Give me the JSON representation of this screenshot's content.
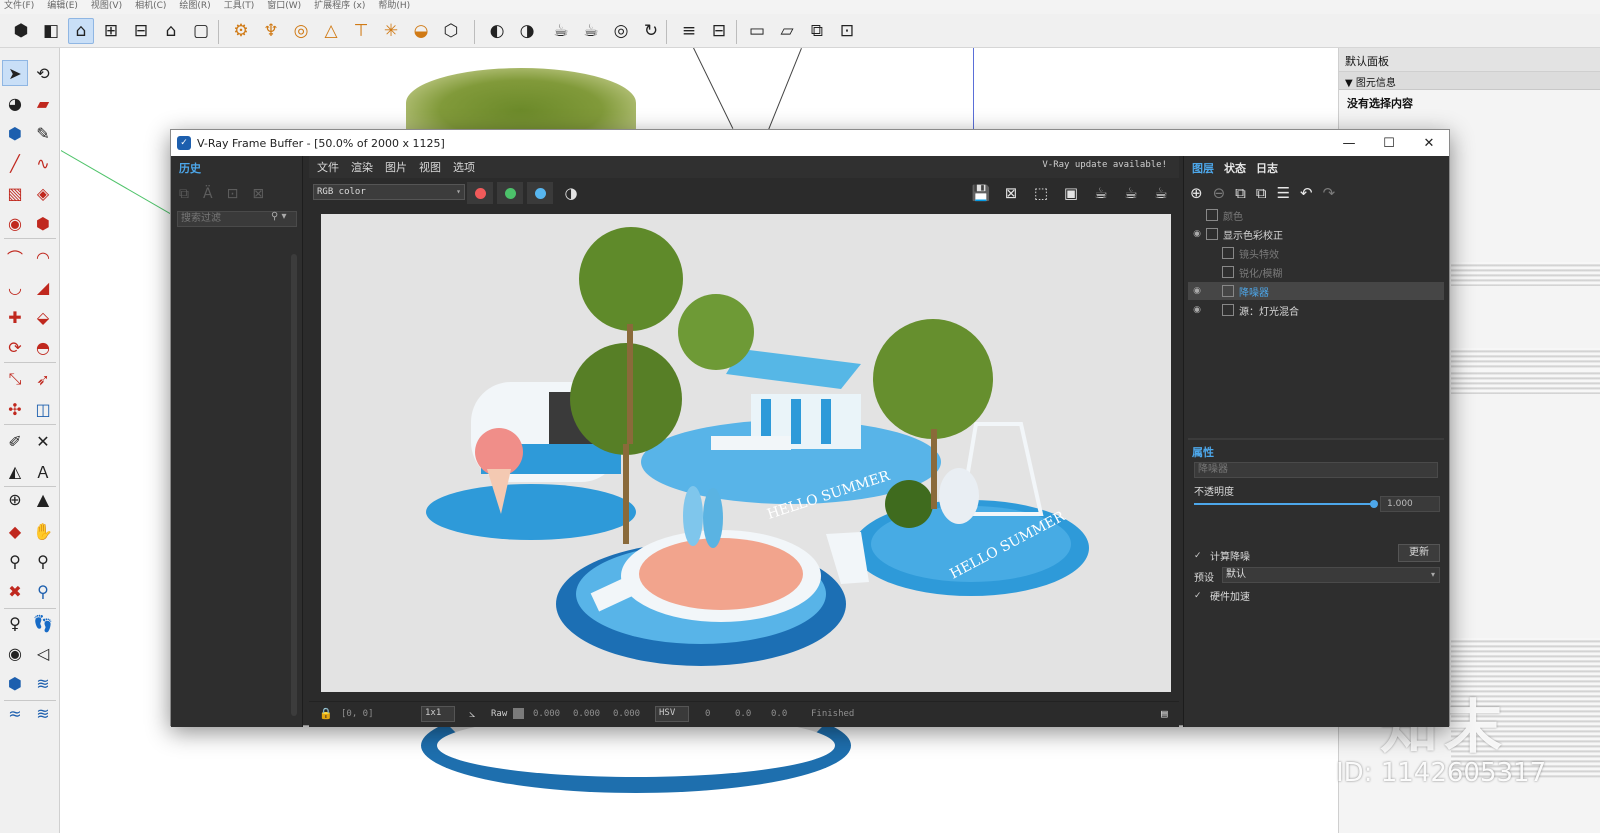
{
  "menubar": [
    "文件(F)",
    "编辑(E)",
    "视图(V)",
    "相机(C)",
    "绘图(R)",
    "工具(T)",
    "窗口(W)",
    "扩展程序 (x)",
    "帮助(H)"
  ],
  "top_toolbar": [
    {
      "name": "components-icon",
      "glyph": "⬢"
    },
    {
      "name": "materials-icon",
      "glyph": "◧"
    },
    {
      "name": "home-icon",
      "glyph": "⌂",
      "active": true
    },
    {
      "name": "warehouse-icon",
      "glyph": "⊞"
    },
    {
      "name": "store-icon",
      "glyph": "⊟"
    },
    {
      "name": "house-icon",
      "glyph": "⌂"
    },
    {
      "name": "box-icon",
      "glyph": "▢"
    },
    {
      "name": "vray-asset-editor-icon",
      "glyph": "⚙",
      "orange": true
    },
    {
      "name": "vray-render-icon",
      "glyph": "♆",
      "orange": true
    },
    {
      "name": "vray-interactive-icon",
      "glyph": "◎",
      "orange": true
    },
    {
      "name": "vray-batch-icon",
      "glyph": "△",
      "orange": true
    },
    {
      "name": "vray-light-icon",
      "glyph": "⊤",
      "orange": true
    },
    {
      "name": "vray-sun-icon",
      "glyph": "✳",
      "orange": true
    },
    {
      "name": "vray-dome-icon",
      "glyph": "◒",
      "orange": true
    },
    {
      "name": "vray-mesh-icon",
      "glyph": "⬡",
      "orange": false
    },
    {
      "name": "vray-proxy-icon",
      "glyph": "◐"
    },
    {
      "name": "vray-fur-icon",
      "glyph": "◑"
    },
    {
      "name": "vray-teapot-icon",
      "glyph": "☕"
    },
    {
      "name": "vray-teapot-play-icon",
      "glyph": "☕"
    },
    {
      "name": "vray-swirl-icon",
      "glyph": "◎"
    },
    {
      "name": "vray-refresh-icon",
      "glyph": "↻"
    },
    {
      "name": "vray-plane-icon",
      "glyph": "≡"
    },
    {
      "name": "vray-clipper-icon",
      "glyph": "⊟"
    },
    {
      "name": "vray-frame-icon",
      "glyph": "▭"
    },
    {
      "name": "vray-frame2-icon",
      "glyph": "▱"
    },
    {
      "name": "vray-frame3-icon",
      "glyph": "⧉"
    },
    {
      "name": "vray-lock-icon",
      "glyph": "⊡"
    }
  ],
  "left_toolbar": [
    {
      "name": "select-tool-icon",
      "glyph": "➤",
      "sel": true
    },
    {
      "name": "orbit-tool-icon",
      "glyph": "⟲"
    },
    {
      "name": "paint-bucket-icon",
      "glyph": "◕"
    },
    {
      "name": "eraser-icon",
      "glyph": "▰",
      "red": true
    },
    {
      "name": "component-tool-icon",
      "glyph": "⬢",
      "blue": true
    },
    {
      "name": "tape-measure-icon",
      "glyph": "✎"
    },
    {
      "name": "pencil-line-icon",
      "glyph": "╱",
      "red": true
    },
    {
      "name": "freehand-icon",
      "glyph": "∿",
      "red": true
    },
    {
      "name": "rectangle-icon",
      "glyph": "▧",
      "red": true
    },
    {
      "name": "rotated-rect-icon",
      "glyph": "◈",
      "red": true
    },
    {
      "name": "circle-icon",
      "glyph": "◉",
      "red": true
    },
    {
      "name": "polygon-icon",
      "glyph": "⬢",
      "red": true
    },
    {
      "name": "arc-icon",
      "glyph": "⌒",
      "red": true
    },
    {
      "name": "arc2-icon",
      "glyph": "◠",
      "red": true
    },
    {
      "name": "arc3-icon",
      "glyph": "◡",
      "red": true
    },
    {
      "name": "pie-icon",
      "glyph": "◢",
      "red": true
    },
    {
      "name": "move-icon",
      "glyph": "✚",
      "red": true
    },
    {
      "name": "push-pull-icon",
      "glyph": "⬙",
      "red": true
    },
    {
      "name": "rotate-icon",
      "glyph": "⟳",
      "red": true
    },
    {
      "name": "follow-me-icon",
      "glyph": "◓",
      "red": true
    },
    {
      "name": "scale-icon",
      "glyph": "⤡",
      "red": true
    },
    {
      "name": "offset-icon",
      "glyph": "➶",
      "red": true
    },
    {
      "name": "axes-icon",
      "glyph": "✣",
      "red": true
    },
    {
      "name": "outer-shell-icon",
      "glyph": "◫",
      "blue": true
    },
    {
      "name": "tape-icon",
      "glyph": "✐"
    },
    {
      "name": "dimension-icon",
      "glyph": "✕"
    },
    {
      "name": "protractor-icon",
      "glyph": "◭"
    },
    {
      "name": "text-icon",
      "glyph": "Ａ"
    },
    {
      "name": "axes-tool-icon",
      "glyph": "⊕"
    },
    {
      "name": "3d-text-icon",
      "glyph": "▲"
    },
    {
      "name": "orbit2-icon",
      "glyph": "◆",
      "red": true
    },
    {
      "name": "pan-icon",
      "glyph": "✋"
    },
    {
      "name": "zoom-icon",
      "glyph": "⚲"
    },
    {
      "name": "zoom-window-icon",
      "glyph": "⚲"
    },
    {
      "name": "zoom-extents-icon",
      "glyph": "✖",
      "red": true
    },
    {
      "name": "previous-view-icon",
      "glyph": "⚲",
      "blue": true
    },
    {
      "name": "position-camera-icon",
      "glyph": "♀"
    },
    {
      "name": "walk-icon",
      "glyph": "👣"
    },
    {
      "name": "look-around-icon",
      "glyph": "◉"
    },
    {
      "name": "section-plane-icon",
      "glyph": "◁"
    },
    {
      "name": "sandbox-icon",
      "glyph": "⬢",
      "blue": true
    },
    {
      "name": "terrain-icon",
      "glyph": "≋",
      "blue": true
    },
    {
      "name": "layers-icon",
      "glyph": "≈",
      "blue": true
    },
    {
      "name": "tools-icon",
      "glyph": "≋",
      "blue": true
    }
  ],
  "default_panel": {
    "title": "默认面板",
    "section": "▼ 图元信息",
    "note": "没有选择内容"
  },
  "watermark": {
    "logo": "知末",
    "id": "ID: 1142605317"
  },
  "vfb": {
    "title": "V-Ray Frame Buffer - [50.0% of 2000 x 1125]",
    "window_buttons": [
      "—",
      "☐",
      "✕"
    ],
    "history_tab": "历史",
    "history_search_placeholder": "搜索过滤",
    "menu": [
      "文件",
      "渲染",
      "图片",
      "视图",
      "选项"
    ],
    "update_note": "V-Ray update available!",
    "channel": "RGB color",
    "channel_colors": [
      "#f05a5a",
      "#4cc16a",
      "#57b6ef"
    ],
    "status": {
      "coords": "[0, 0]",
      "ratio": "1x1",
      "raw_label": "Raw",
      "raw_values": [
        "0.000",
        "0.000",
        "0.000"
      ],
      "mode": "HSV",
      "hsv_values": [
        "0",
        "0.0",
        "0.0"
      ],
      "state": "Finished"
    },
    "layer_tabs": [
      "图层",
      "状态",
      "日志"
    ],
    "layers": [
      {
        "label": "颜色",
        "dim": true,
        "indent": 0,
        "eye": false
      },
      {
        "label": "显示色彩校正",
        "dim": false,
        "indent": 0,
        "eye": true
      },
      {
        "label": "镜头特效",
        "dim": true,
        "indent": 1,
        "eye": false
      },
      {
        "label": "锐化/模糊",
        "dim": true,
        "indent": 1,
        "eye": false
      },
      {
        "label": "降噪器",
        "dim": false,
        "indent": 1,
        "eye": true,
        "sel": true,
        "accent": true
      },
      {
        "label": "源：灯光混合",
        "dim": false,
        "indent": 1,
        "eye": true
      }
    ],
    "properties": {
      "title": "属性",
      "name_field": "降噪器",
      "opacity_label": "不透明度",
      "opacity_value": "1.000",
      "opacity": 1.0,
      "compute_label": "计算降噪",
      "update_button": "更新",
      "preset_label": "预设",
      "preset_value": "默认",
      "hw_label": "硬件加速"
    }
  },
  "render_scene": {
    "signs": [
      "HELLO SUMMER",
      "HELLO SUMMER"
    ],
    "colors": {
      "blue": "#2e9ad9",
      "deep_blue": "#1c6fb4",
      "sand": "#f2a48d",
      "white": "#f2f6f9",
      "palm": "#5f8a2a"
    }
  }
}
